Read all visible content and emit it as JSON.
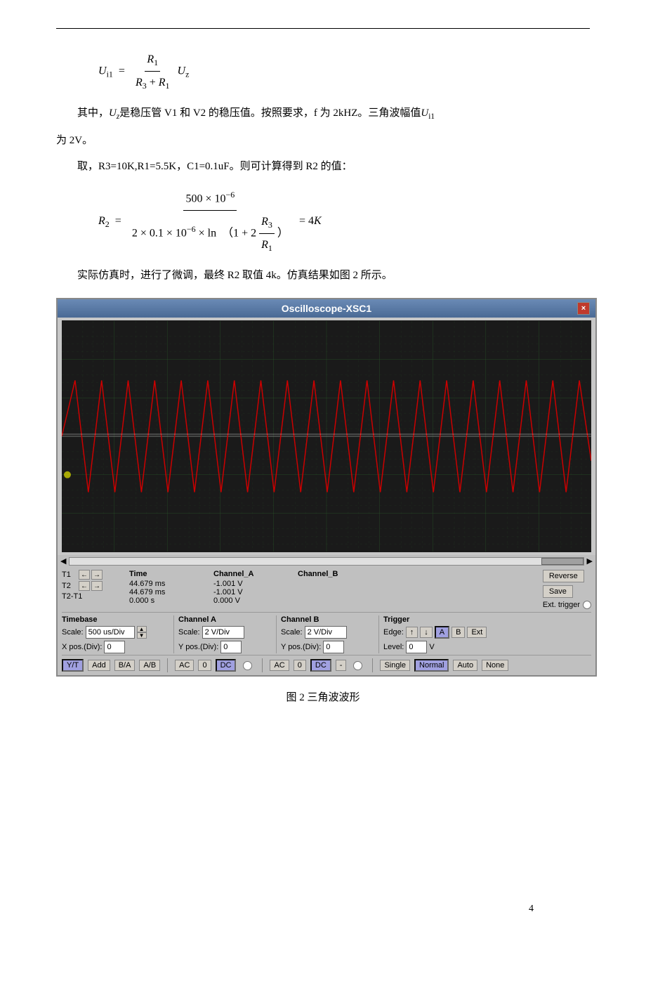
{
  "divider": "---",
  "formula1": {
    "lhs": "U",
    "lhs_sub": "i1",
    "rhs_numer": "R",
    "rhs_numer_sub": "1",
    "rhs_denom_a": "R",
    "rhs_denom_a_sub": "3",
    "rhs_denom_b": "R",
    "rhs_denom_b_sub": "1",
    "rhs_var": "U",
    "rhs_var_sub": "z"
  },
  "para1": "其中，U₂是稳压管 V1 和 V2 的稳压值。按照要求，f 为 2kHZ。三角波幅值Uᵢ₁为 2V。",
  "para2": "取，R3=10K,R1=5.5K，C1=0.1uF。则可计算得到 R2 的值：",
  "formula2_lhs": "R",
  "formula2_lhs_sub": "2",
  "formula2_numer": "500 × 10⁻⁶",
  "formula2_denom": "2 × 0.1 × 10⁻⁶ × ln （1 + 2R₃/R₁）",
  "formula2_rhs": "= 4K",
  "para3": "实际仿真时，进行了微调，最终 R2 取值 4k。仿真结果如图 2 所示。",
  "oscilloscope": {
    "title": "Oscilloscope-XSC1",
    "close_label": "×",
    "t1_label": "T1",
    "t2_label": "T2",
    "t2t1_label": "T2-T1",
    "time_label": "Time",
    "t1_time": "44.679 ms",
    "t2_time": "44.679 ms",
    "t2t1_time": "0.000 s",
    "channel_a_label": "Channel_A",
    "channel_b_label": "Channel_B",
    "t1_cha": "-1.001 V",
    "t2_cha": "-1.001 V",
    "t2t1_cha": "0.000 V",
    "reverse_label": "Reverse",
    "save_label": "Save",
    "ext_trigger_label": "Ext. trigger",
    "timebase_label": "Timebase",
    "scale_label": "Scale:",
    "timebase_value": "500 us/Div",
    "xpos_label": "X pos.(Div):",
    "xpos_value": "0",
    "cha_label": "Channel A",
    "cha_scale_label": "Scale:",
    "cha_scale_value": "2 V/Div",
    "cha_ypos_label": "Y pos.(Div):",
    "cha_ypos_value": "0",
    "chb_label": "Channel B",
    "chb_scale_label": "Scale:",
    "chb_scale_value": "2 V/Div",
    "chb_ypos_label": "Y pos.(Div):",
    "chb_ypos_value": "0",
    "trigger_label": "Trigger",
    "edge_label": "Edge:",
    "edge_btns": [
      "↑",
      "↓",
      "A",
      "B",
      "Ext"
    ],
    "level_label": "Level:",
    "level_value": "0",
    "level_unit": "V",
    "btn_yt": "Y/T",
    "btn_add": "Add",
    "btn_ba": "B/A",
    "btn_ab": "A/B",
    "btn_ac1": "AC",
    "btn_0_1": "0",
    "btn_dc1": "DC",
    "btn_ac2": "AC",
    "btn_0_2": "0",
    "btn_dc2": "DC",
    "btn_dash": "-",
    "btn_single": "Single",
    "btn_normal": "Normal",
    "btn_auto": "Auto",
    "btn_none": "None"
  },
  "fig_caption": "图 2 三角波波形",
  "page_number": "4"
}
